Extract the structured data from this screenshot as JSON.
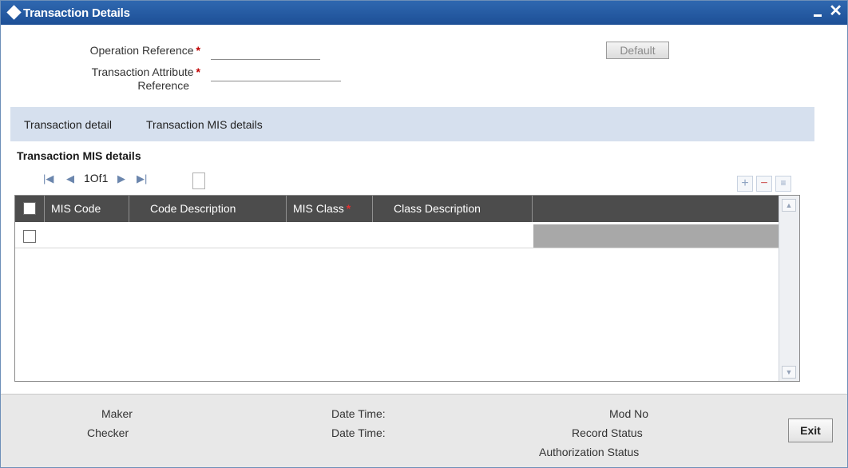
{
  "window": {
    "title": "Transaction Details",
    "controls": {
      "minimize": "minimize",
      "close": "✕"
    }
  },
  "form": {
    "operation_reference": {
      "label": "Operation Reference",
      "required_marker": "*",
      "value": ""
    },
    "transaction_attribute_reference": {
      "label_line1": "Transaction Attribute",
      "label_line2": "Reference",
      "required_marker": "*",
      "value": ""
    },
    "default_button": "Default"
  },
  "tabs": [
    {
      "label": "Transaction detail"
    },
    {
      "label": "Transaction MIS details"
    }
  ],
  "section": {
    "title": "Transaction MIS details",
    "pager": {
      "first_icon": "first-page-icon",
      "prev_icon": "prev-page-icon",
      "text": "1Of1",
      "next_icon": "next-page-icon",
      "last_icon": "last-page-icon"
    },
    "toolbar_icons": [
      "add-row-icon",
      "delete-row-icon",
      "view-row-icon"
    ]
  },
  "grid": {
    "columns": [
      {
        "label": "MIS Code",
        "required": false
      },
      {
        "label": "Code Description",
        "required": false
      },
      {
        "label": "MIS Class",
        "required": true,
        "required_marker": "*"
      },
      {
        "label": "Class Description",
        "required": false
      }
    ],
    "rows": [
      {
        "selected": false,
        "mis_code": "",
        "code_description": "",
        "mis_class": "",
        "class_description": ""
      }
    ]
  },
  "footer": {
    "maker": "Maker",
    "checker": "Checker",
    "date_time_1": "Date Time:",
    "date_time_2": "Date Time:",
    "mod_no": "Mod No",
    "record_status": "Record Status",
    "authorization_status": "Authorization Status",
    "exit_button": "Exit"
  }
}
